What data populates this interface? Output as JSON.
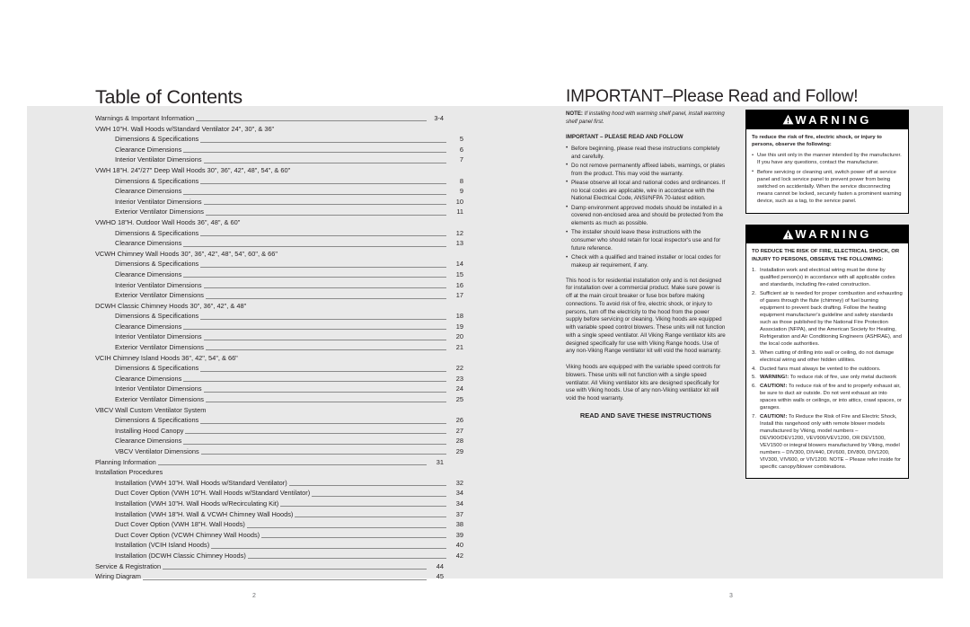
{
  "left_page": {
    "title": "Table of Contents",
    "folio": "2",
    "toc": [
      {
        "label": "Warnings & Important Information",
        "page": "3-4",
        "level": 0,
        "dots": true
      },
      {
        "label": "VWH 10\"H. Wall Hoods w/Standard Ventilator 24\", 30\", & 36\"",
        "page": "",
        "level": 0,
        "dots": false
      },
      {
        "label": "Dimensions & Specifications",
        "page": "5",
        "level": 1,
        "dots": true
      },
      {
        "label": "Clearance Dimensions",
        "page": "6",
        "level": 1,
        "dots": true
      },
      {
        "label": "Interior Ventilator Dimensions",
        "page": "7",
        "level": 1,
        "dots": true
      },
      {
        "label": "VWH 18\"H. 24\"/27\" Deep Wall Hoods 30\", 36\", 42\", 48\", 54\", & 60\"",
        "page": "",
        "level": 0,
        "dots": false
      },
      {
        "label": "Dimensions & Specifications",
        "page": "8",
        "level": 1,
        "dots": true
      },
      {
        "label": "Clearance Dimensions",
        "page": "9",
        "level": 1,
        "dots": true
      },
      {
        "label": "Interior Ventilator Dimensions",
        "page": "10",
        "level": 1,
        "dots": true
      },
      {
        "label": "Exterior Ventilator Dimensions",
        "page": "11",
        "level": 1,
        "dots": true
      },
      {
        "label": "VWHO 18\"H. Outdoor Wall Hoods 36\", 48\", & 60\"",
        "page": "",
        "level": 0,
        "dots": false
      },
      {
        "label": "Dimensions & Specifications",
        "page": "12",
        "level": 1,
        "dots": true
      },
      {
        "label": "Clearance Dimensions",
        "page": "13",
        "level": 1,
        "dots": true
      },
      {
        "label": "VCWH Chimney Wall Hoods 30\", 36\", 42\", 48\", 54\", 60\", & 66\"",
        "page": "",
        "level": 0,
        "dots": false
      },
      {
        "label": "Dimensions & Specifications",
        "page": "14",
        "level": 1,
        "dots": true
      },
      {
        "label": "Clearance Dimensions",
        "page": "15",
        "level": 1,
        "dots": true
      },
      {
        "label": "Interior Ventilator Dimensions",
        "page": "16",
        "level": 1,
        "dots": true
      },
      {
        "label": "Exterior Ventilator Dimensions",
        "page": "17",
        "level": 1,
        "dots": true
      },
      {
        "label": "DCWH Classic Chimney Hoods 30\", 36\", 42\", & 48\"",
        "page": "",
        "level": 0,
        "dots": false
      },
      {
        "label": "Dimensions & Specifications",
        "page": "18",
        "level": 1,
        "dots": true
      },
      {
        "label": "Clearance Dimensions",
        "page": "19",
        "level": 1,
        "dots": true
      },
      {
        "label": "Interior Ventilator Dimensions",
        "page": "20",
        "level": 1,
        "dots": true
      },
      {
        "label": "Exterior Ventilator Dimensions",
        "page": "21",
        "level": 1,
        "dots": true
      },
      {
        "label": "VCIH Chimney Island Hoods 36\", 42\", 54\", & 66\"",
        "page": "",
        "level": 0,
        "dots": false
      },
      {
        "label": "Dimensions & Specifications",
        "page": "22",
        "level": 1,
        "dots": true
      },
      {
        "label": "Clearance Dimensions",
        "page": "23",
        "level": 1,
        "dots": true
      },
      {
        "label": "Interior Ventilator Dimensions",
        "page": "24",
        "level": 1,
        "dots": true
      },
      {
        "label": "Exterior Ventilator Dimensions",
        "page": "25",
        "level": 1,
        "dots": true
      },
      {
        "label": "VBCV Wall Custom Ventilator System",
        "page": "",
        "level": 0,
        "dots": false
      },
      {
        "label": "Dimensions & Specifications",
        "page": "26",
        "level": 1,
        "dots": true
      },
      {
        "label": "Installing Hood Canopy",
        "page": "27",
        "level": 1,
        "dots": true
      },
      {
        "label": "Clearance Dimensions",
        "page": "28",
        "level": 1,
        "dots": true
      },
      {
        "label": "VBCV Ventilator Dimensions",
        "page": "29",
        "level": 1,
        "dots": true
      },
      {
        "label": "Planning Information",
        "page": "31",
        "level": 0,
        "dots": true
      },
      {
        "label": "Installation Procedures",
        "page": "",
        "level": 0,
        "dots": false
      },
      {
        "label": "Installation (VWH 10\"H. Wall Hoods w/Standard Ventilator)",
        "page": "32",
        "level": 1,
        "dots": true
      },
      {
        "label": "Duct Cover Option (VWH 10\"H. Wall Hoods w/Standard Ventilator)",
        "page": "34",
        "level": 1,
        "dots": true
      },
      {
        "label": "Installation (VWH 10\"H. Wall Hoods w/Recirculating Kit)",
        "page": "34",
        "level": 1,
        "dots": true
      },
      {
        "label": "Installation (VWH 18\"H. Wall & VCWH Chimney Wall Hoods)",
        "page": "37",
        "level": 1,
        "dots": true
      },
      {
        "label": "Duct Cover Option (VWH 18\"H. Wall Hoods)",
        "page": "38",
        "level": 1,
        "dots": true
      },
      {
        "label": "Duct Cover Option (VCWH Chimney Wall Hoods)",
        "page": "39",
        "level": 1,
        "dots": true
      },
      {
        "label": "Installation (VCIH Island Hoods)",
        "page": "40",
        "level": 1,
        "dots": true
      },
      {
        "label": "Installation (DCWH Classic Chimney Hoods)",
        "page": "42",
        "level": 1,
        "dots": true
      },
      {
        "label": "Service & Registration",
        "page": "44",
        "level": 0,
        "dots": true
      },
      {
        "label": "Wiring Diagram",
        "page": "45",
        "level": 0,
        "dots": true
      }
    ]
  },
  "right_page": {
    "title_strong": "IMPORTANT",
    "title_rest": "–Please Read and Follow!",
    "folio": "3",
    "note_label": "NOTE:",
    "note_text": " If installing hood with warming shelf panel, install warming shelf panel first.",
    "important_head": "IMPORTANT – PLEASE READ AND FOLLOW",
    "important_bullets": [
      "Before beginning, please read these instructions completely and carefully.",
      "Do not remove permanently affixed labels, warnings, or plates from the product. This may void the warranty.",
      "Please observe all local and national codes and ordinances. If no local codes are applicable, wire in accordance with the National Electrical Code, ANSI/NFPA 70-latest edition.",
      "Damp environment approved models should be installed in a covered non-enclosed area and should be protected from the elements as much as possible.",
      "The installer should leave these instructions with the consumer who should retain for local inspector's use and for future reference.",
      "Check with a qualified and trained installer or local codes for makeup air requirement, if any."
    ],
    "paragraph_1": "This hood is for residential installation only and is not designed for installation over a commercial product. Make sure power is off at the main circuit breaker or fuse box before making connections. To avoid risk of fire, electric shock, or injury to persons, turn off the electricity to the hood from the power supply before servicing or cleaning. Viking hoods are equipped with variable speed control blowers. These units will not function with a single speed ventilator. All Viking Range ventilator kits are designed specifically for use with Viking Range hoods. Use of any non-Viking Range ventilator kit will void the hood warranty.",
    "paragraph_2": "Viking hoods are equipped with the variable speed controls for blowers. These units will not function with a single speed ventilator. All Viking ventilator kits are designed specifically for use with Viking hoods. Use of any non-Viking ventilator kit will void the hood warranty.",
    "read_save": "READ AND SAVE THESE INSTRUCTIONS",
    "warning_1": {
      "heading": "WARNING",
      "lead": "To reduce the risk of fire, electric shock, or injury to persons, observe the following:",
      "bullets": [
        "Use this unit only in the manner intended by the manufacturer. If you have any questions, contact the manufacturer.",
        "Before servicing or cleaning unit, switch power off at service panel and lock service panel to prevent power from being switched on accidentally. When the service disconnecting means cannot be locked, securely fasten a prominent warning device, such as a tag, to the service panel."
      ]
    },
    "warning_2": {
      "heading": "WARNING",
      "lead": "TO REDUCE THE RISK OF FIRE, ELECTRICAL SHOCK, OR INJURY TO PERSONS, OBSERVE THE FOLLOWING:",
      "items": [
        {
          "bold": "",
          "text": "Installation work and electrical wiring must be done by qualified person(s) in accordance with all applicable codes and standards, including fire-rated construction."
        },
        {
          "bold": "",
          "text": "Sufficient air is needed for proper combustion and exhausting of gases through the flute (chimney) of fuel burning equipment to prevent back drafting. Follow the heating equipment manufacturer's guideline and safety standards such as those published by the National Fire Protection Association (NFPA), and the American Society for Heating, Refrigeration and Air Conditioning Engineers (ASHRAE), and the local code authorities."
        },
        {
          "bold": "",
          "text": "When cutting of drilling into wall or ceiling, do not damage electrical wiring and other hidden utilities."
        },
        {
          "bold": "",
          "text": "Ducted fans must always be vented to the outdoors."
        },
        {
          "bold": "WARNING!:",
          "text": " To reduce risk of fire, use only metal ductwork"
        },
        {
          "bold": "CAUTION!:",
          "text": " To reduce risk of fire and to properly exhaust air, be sure to duct air outside. Do not vent exhaust air into spaces within walls or ceilings, or into attics, crawl spaces, or garages."
        },
        {
          "bold": "CAUTION!:",
          "text": " To Reduce the Risk of Fire and Electric Shock, Install this rangehood only with remote blower models manufactured by Viking, model numbers – DEV900/DEV1200, VEV900/VEV1200, OR DEV1500, VEV1500 or integral blowers manufactured by Viking, model numbers – DIV300, DIV440, DIV600, DIV800, DIV1200, VIV300, VIV600, or VIV1200. NOTE – Please refer inside for specific canopy/blower combinations."
        }
      ]
    }
  }
}
